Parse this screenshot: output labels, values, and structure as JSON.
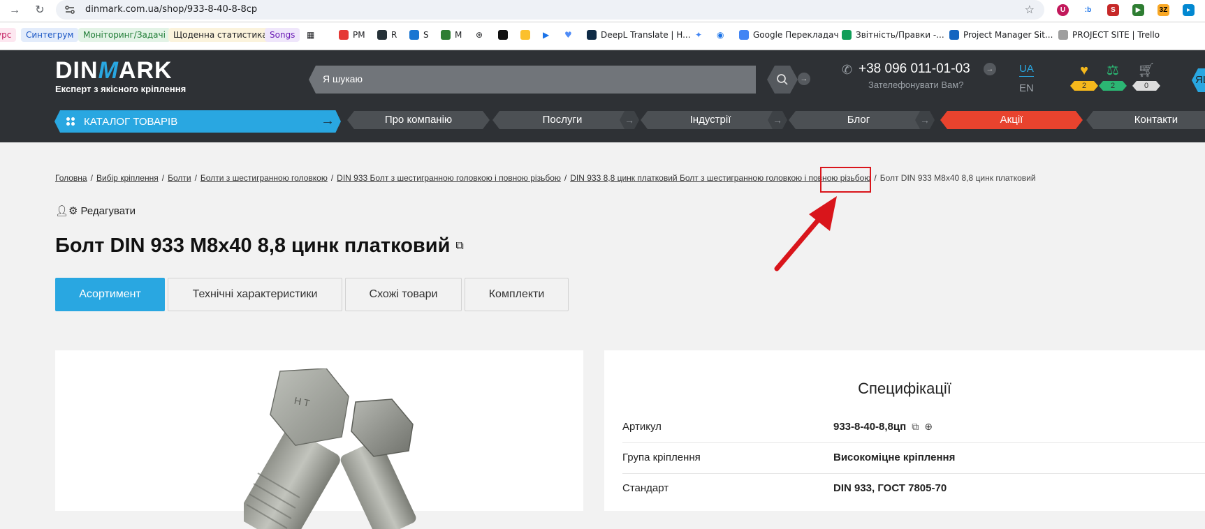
{
  "browser": {
    "url": "dinmark.com.ua/shop/933-8-40-8-8cp",
    "bookmarks": [
      {
        "label": "урс",
        "bg": "#fde7f0",
        "color": "#c2185b"
      },
      {
        "label": "Синтегрум",
        "bg": "#e3ecfb",
        "color": "#1a56c4"
      },
      {
        "label": "Моніторинг/Задачі",
        "bg": "#e3f3e6",
        "color": "#1e7b34"
      },
      {
        "label": "Щоденна статистика",
        "bg": "#fbf3dc",
        "color": "#202124"
      },
      {
        "label": "Songs",
        "bg": "#efe6fb",
        "color": "#6a1bb5"
      },
      {
        "label": "PM"
      },
      {
        "label": "R"
      },
      {
        "label": "S"
      },
      {
        "label": "M"
      },
      {
        "label": "DeepL Translate | H..."
      },
      {
        "label": "Google Перекладач"
      },
      {
        "label": "Звітність/Правки -..."
      },
      {
        "label": "Project Manager Sit..."
      },
      {
        "label": "PROJECT SITE | Trello"
      }
    ]
  },
  "header": {
    "logo_word_a": "DIN",
    "logo_word_m": "M",
    "logo_word_b": "ARK",
    "logo_tagline": "Експерт з якісного кріплення",
    "search_placeholder": "Я шукаю",
    "phone": "+38 096 011-01-03",
    "callback": "Зателефонувати Вам?",
    "lang_active": "UA",
    "lang_other": "EN",
    "favorites_count": "2",
    "compare_count": "2",
    "cart_count": "0",
    "lang_tab": "ЯЦ",
    "catalog_label": "КАТАЛОГ ТОВАРІВ",
    "nav": {
      "about": "Про компанію",
      "services": "Послуги",
      "industries": "Індустрії",
      "blog": "Блог",
      "promo": "Акції",
      "contacts": "Контакти"
    },
    "colors": {
      "accent": "#29a7e1",
      "promo": "#e8432e",
      "header_bg": "#2e3135"
    }
  },
  "breadcrumb": [
    "Головна",
    "Вибір кріплення",
    "Болти",
    "Болти з шестигранною головкою",
    "DIN 933 Болт з шестигранною головкою і повною різьбою",
    "DIN 933 8,8 цинк платковий Болт з шестигранною головкою і повною різьбою"
  ],
  "breadcrumb_current": "Болт DIN 933 M8x40 8,8 цинк платковий",
  "edit_label": "Редагувати",
  "product_title": "Болт DIN 933 M8x40 8,8 цинк платковий",
  "tabs": [
    "Асортимент",
    "Технічні характеристики",
    "Схожі товари",
    "Комплекти"
  ],
  "specs": {
    "title": "Специфікації",
    "rows": [
      {
        "key": "Артикул",
        "value": "933-8-40-8,8цп"
      },
      {
        "key": "Група кріплення",
        "value": "Високоміцне кріплення"
      },
      {
        "key": "Стандарт",
        "value": "DIN 933, ГОСТ 7805-70"
      }
    ]
  },
  "annotation_color": "#d9151b"
}
